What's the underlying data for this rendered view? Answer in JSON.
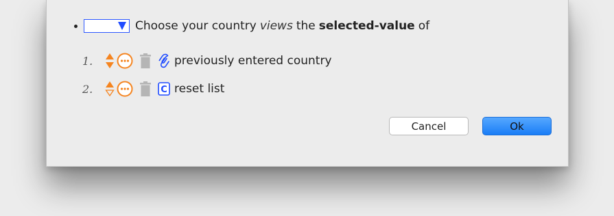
{
  "colors": {
    "select_border": "#2b57ff",
    "accent_orange": "#f5841f",
    "clip_blue": "#1f4bff",
    "ok_button": "#1a7df6"
  },
  "statement": {
    "select_value": "",
    "text_before": "Choose your country",
    "keyword_views": "views",
    "text_the": "the",
    "keyword_selected_value": "selected-value",
    "text_of": "of"
  },
  "list": {
    "items": [
      {
        "number": "1.",
        "label": "previously entered country",
        "kind_icon": "paperclip-icon"
      },
      {
        "number": "2.",
        "label": "reset list",
        "kind_icon": "constant-c-icon"
      }
    ],
    "constant_icon_letter": "C"
  },
  "buttons": {
    "cancel_label": "Cancel",
    "ok_label": "Ok"
  }
}
